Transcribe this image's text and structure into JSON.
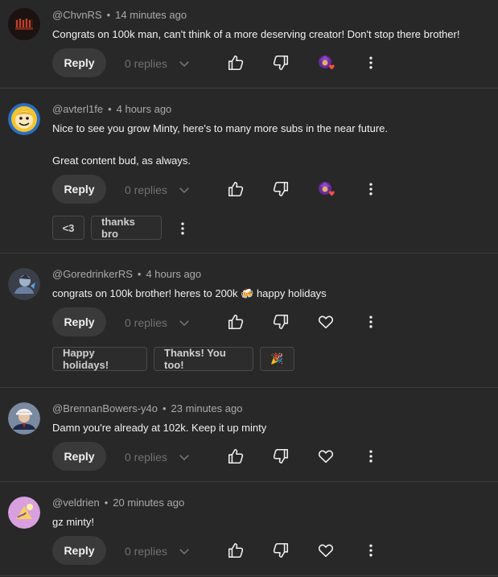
{
  "reply_label": "Reply",
  "comments": [
    {
      "author": "@ChvnRS",
      "time": "14 minutes ago",
      "lines": [
        "Congrats on 100k man, can't think of a more deserving creator! Don't stop there brother!"
      ],
      "replies": "0 replies",
      "hearted": true
    },
    {
      "author": "@avterl1fe",
      "time": "4 hours ago",
      "lines": [
        "Nice to see you grow Minty, here's to many more subs in the near future.",
        "Great content bud, as always."
      ],
      "replies": "0 replies",
      "hearted": true,
      "suggestions": [
        "<3",
        "thanks bro"
      ]
    },
    {
      "author": "@GoredrinkerRS",
      "time": "4 hours ago",
      "lines": [
        "congrats on 100k brother! heres to 200k 🍻 happy holidays"
      ],
      "replies": "0 replies",
      "hearted": false,
      "suggestions": [
        "Happy holidays!",
        "Thanks! You too!",
        "🎉"
      ]
    },
    {
      "author": "@BrennanBowers-y4o",
      "time": "23 minutes ago",
      "lines": [
        "Damn you're already at 102k. Keep it up minty"
      ],
      "replies": "0 replies",
      "hearted": false
    },
    {
      "author": "@veldrien",
      "time": "20 minutes ago",
      "lines": [
        "gz minty!"
      ],
      "replies": "0 replies",
      "hearted": false
    }
  ]
}
